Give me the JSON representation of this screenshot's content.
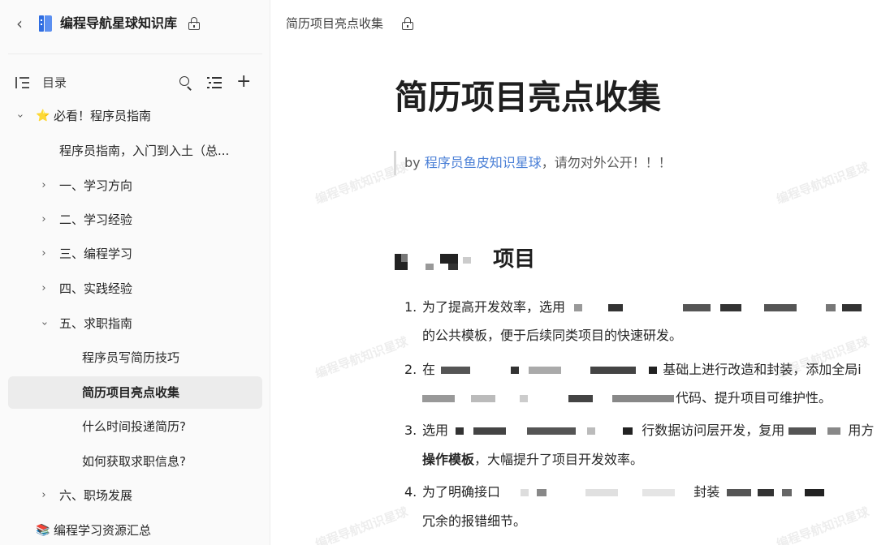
{
  "kb": {
    "title": "编程导航星球知识库"
  },
  "toc": {
    "label": "目录"
  },
  "tree": [
    {
      "label": "必看！程序员指南",
      "emoji": "⭐"
    },
    {
      "label": "程序员指南，入门到入土（总..."
    },
    {
      "label": "一、学习方向"
    },
    {
      "label": "二、学习经验"
    },
    {
      "label": "三、编程学习"
    },
    {
      "label": "四、实践经验"
    },
    {
      "label": "五、求职指南"
    },
    {
      "label": "程序员写简历技巧"
    },
    {
      "label": "简历项目亮点收集"
    },
    {
      "label": "什么时间投递简历?"
    },
    {
      "label": "如何获取求职信息?"
    },
    {
      "label": "六、职场发展"
    },
    {
      "label": "编程学习资源汇总",
      "emoji": "📚"
    }
  ],
  "doc": {
    "breadcrumb": "简历项目亮点收集",
    "title": "简历项目亮点收集",
    "quote_by": "by ",
    "quote_link": "程序员鱼皮知识星球",
    "quote_rest": "，请勿对外公开！！！",
    "section_heading": "项目",
    "items": [
      {
        "num": "1.",
        "line1": "为了提高开发效率，选用",
        "line2": "的公共模板，便于后续同类项目的快速研发。"
      },
      {
        "num": "2.",
        "line1_a": "在",
        "line1_b": "基础上进行改造和封装，添加全局i",
        "line2": "代码、提升项目可维护性。"
      },
      {
        "num": "3.",
        "line1_a": "选用",
        "line1_b": "行数据访问层开发，复用",
        "line1_c": "用方",
        "line2_bold": "操作模板",
        "line2_rest": "，大幅提升了项目开发效率。"
      },
      {
        "num": "4.",
        "line1_a": "为了明确接口",
        "line1_b": "封装",
        "line2": "冗余的报错细节。"
      }
    ],
    "watermark": "编程导航知识星球"
  }
}
